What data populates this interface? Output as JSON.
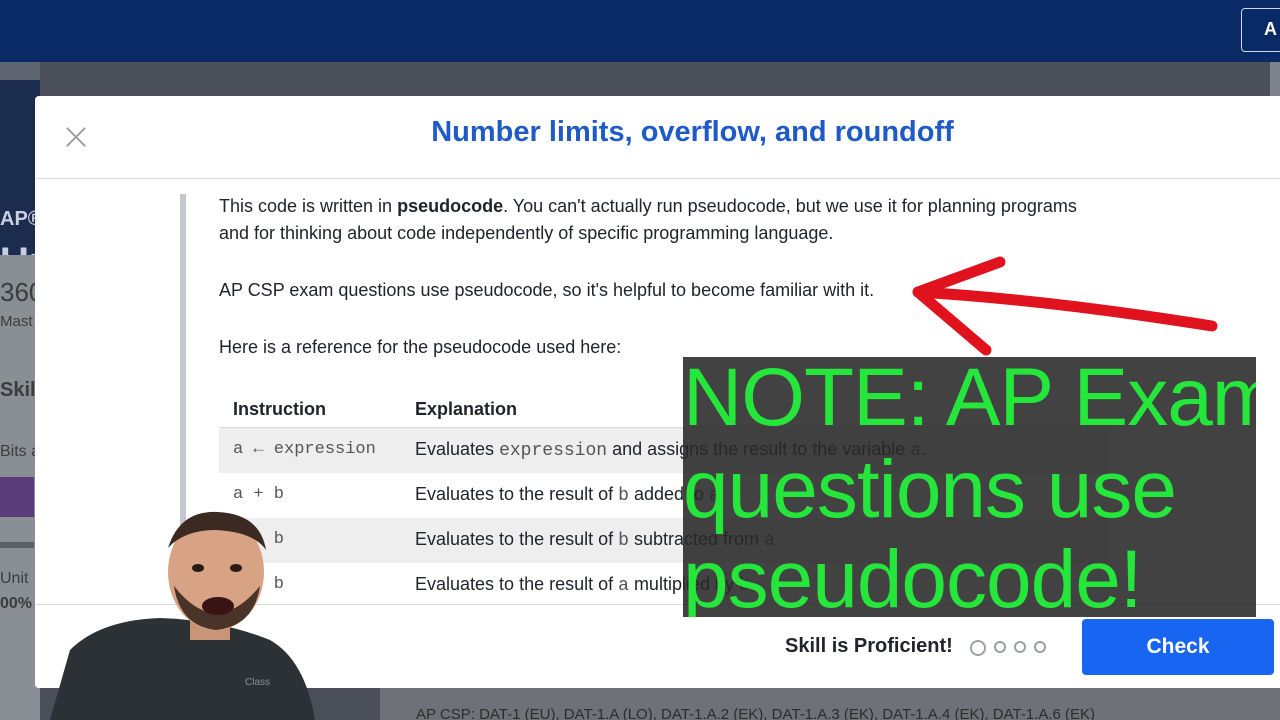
{
  "app": {
    "topbar_button_label": "A",
    "bg_ap": "AP®",
    "bg_unit": "Ur",
    "bg_number": "360",
    "bg_mast": "Mast",
    "bg_skill": "Skill",
    "bg_bits": "Bits a",
    "bg_unit2": "Unit",
    "bg_percent": "00%",
    "footer_standards": "AP CSP: DAT-1 (EU), DAT-1.A (LO), DAT-1.A.2 (EK), DAT-1.A.3 (EK), DAT-1.A.4 (EK), DAT-1.A.6 (EK)"
  },
  "modal": {
    "title": "Number limits, overflow, and roundoff",
    "intro_before": "This code is written in ",
    "intro_bold": "pseudocode",
    "intro_after": ". You can't actually run pseudocode, but we use it for planning programs and for thinking about code independently of specific programming language.",
    "exam_note": "AP CSP exam questions use pseudocode, so it's helpful to become familiar with it.",
    "reference_intro": "Here is a reference for the pseudocode used here:",
    "table": {
      "headers": [
        "Instruction",
        "Explanation"
      ],
      "rows": [
        {
          "instr": "a ← expression",
          "pre": "Evaluates ",
          "code": "expression",
          "post": " and assigns the result to the variable ",
          "code2": "a",
          "end": "."
        },
        {
          "instr": "a + b",
          "pre": "Evaluates to the result of ",
          "code": "b",
          "post": " added to ",
          "code2": "a",
          "end": ""
        },
        {
          "instr": "a - b",
          "pre": "Evaluates to the result of ",
          "code": "b",
          "post": " subtracted from ",
          "code2": "a",
          "end": ""
        },
        {
          "instr": "a * b",
          "pre": "Evaluates to the result of ",
          "code": "a",
          "post": " multiplied by ",
          "code2": "b",
          "end": ""
        }
      ]
    },
    "footer": {
      "skill_status": "Skill is Proficient!",
      "check_label": "Check"
    }
  },
  "overlay": {
    "note_lines": [
      "NOTE: AP Exam",
      "questions use",
      "pseudocode!"
    ],
    "note_color": "#25e63a",
    "arrow_color": "#e0121d"
  },
  "colors": {
    "accent": "#1865f2",
    "title": "#1e5bc6",
    "topbar": "#0a2a66"
  }
}
